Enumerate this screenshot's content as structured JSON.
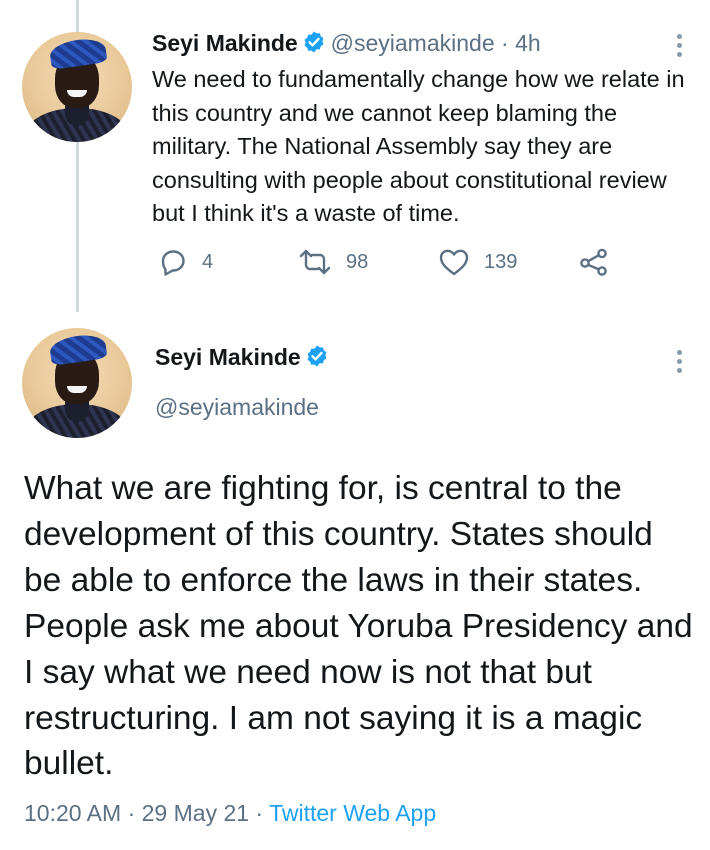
{
  "tweet1": {
    "name": "Seyi Makinde",
    "handle": "@seyiamakinde",
    "separator": " · ",
    "time": "4h",
    "text": "We need to fundamentally change how we relate in this country and we cannot keep blaming the military. The National Assembly say they are consulting with people about constitutional review but I think it's a waste of time.",
    "replies": "4",
    "retweets": "98",
    "likes": "139",
    "icons": [
      "verified-badge-icon",
      "more-vertical-icon",
      "reply-icon",
      "retweet-icon",
      "like-icon",
      "share-icon"
    ]
  },
  "tweet2": {
    "name": "Seyi Makinde",
    "handle": "@seyiamakinde",
    "text": "What we are fighting for, is central to the development of this country. States should be able to enforce the laws in their states. People ask me about Yoruba Presidency and I say what we need now is not that but restructuring. I am not saying it is a magic bullet.",
    "time": "10:20 AM",
    "separator": " · ",
    "date": "29 May 21",
    "source": "Twitter Web App"
  },
  "colors": {
    "accent": "#1da1f2",
    "text": "#14171a",
    "secondary": "#5b7083",
    "thread_line": "#cfd9de"
  }
}
